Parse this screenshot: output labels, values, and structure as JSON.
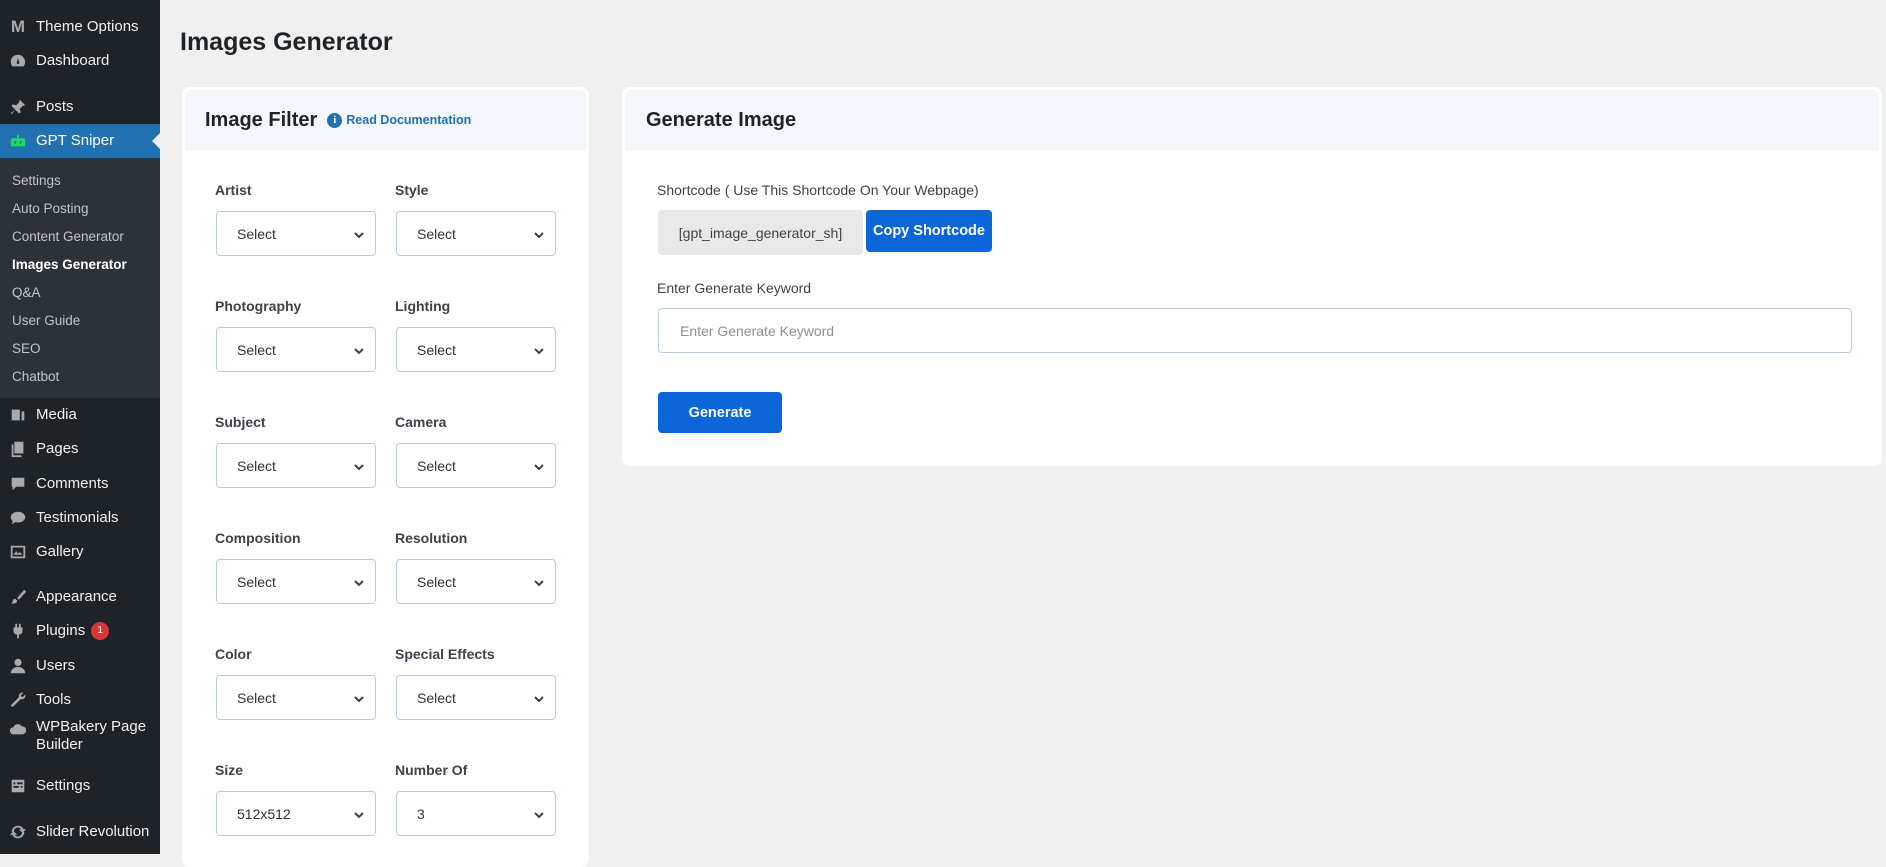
{
  "sidebar": {
    "top_items": [
      {
        "label": "Theme Options",
        "icon": "m-logo-icon"
      },
      {
        "label": "Dashboard",
        "icon": "dashboard-icon"
      },
      {
        "label": "Posts",
        "icon": "pin-icon"
      },
      {
        "label": "GPT Sniper",
        "icon": "robot-icon"
      }
    ],
    "submenu": [
      "Settings",
      "Auto Posting",
      "Content Generator",
      "Images Generator",
      "Q&A",
      "User Guide",
      "SEO",
      "Chatbot"
    ],
    "current_submenu": "Images Generator",
    "bottom_items": [
      {
        "label": "Media",
        "icon": "media-icon"
      },
      {
        "label": "Pages",
        "icon": "pages-icon"
      },
      {
        "label": "Comments",
        "icon": "comment-icon"
      },
      {
        "label": "Testimonials",
        "icon": "testimonial-icon"
      },
      {
        "label": "Gallery",
        "icon": "gallery-icon"
      },
      {
        "label": "Appearance",
        "icon": "brush-icon"
      },
      {
        "label": "Plugins",
        "icon": "plugin-icon",
        "badge": "1"
      },
      {
        "label": "Users",
        "icon": "user-icon"
      },
      {
        "label": "Tools",
        "icon": "wrench-icon"
      },
      {
        "label": "WPBakery Page",
        "label2": "Builder",
        "icon": "cloud-icon"
      },
      {
        "label": "Settings",
        "icon": "settings-icon"
      },
      {
        "label": "Slider Revolution",
        "icon": "refresh-icon"
      }
    ],
    "colors": {
      "bg": "#1d2327",
      "active": "#2271b1",
      "submenu_bg": "#2c3338"
    }
  },
  "page": {
    "title": "Images Generator"
  },
  "filter": {
    "title": "Image Filter",
    "doc_link": "Read Documentation",
    "fields": [
      {
        "label": "Artist",
        "value": "Select"
      },
      {
        "label": "Style",
        "value": "Select"
      },
      {
        "label": "Photography",
        "value": "Select"
      },
      {
        "label": "Lighting",
        "value": "Select"
      },
      {
        "label": "Subject",
        "value": "Select"
      },
      {
        "label": "Camera",
        "value": "Select"
      },
      {
        "label": "Composition",
        "value": "Select"
      },
      {
        "label": "Resolution",
        "value": "Select"
      },
      {
        "label": "Color",
        "value": "Select"
      },
      {
        "label": "Special Effects",
        "value": "Select"
      },
      {
        "label": "Size",
        "value": "512x512"
      },
      {
        "label": "Number Of",
        "value": "3"
      }
    ]
  },
  "generate": {
    "title": "Generate Image",
    "shortcode_label": "Shortcode ( Use This Shortcode On Your Webpage)",
    "shortcode_value": "[gpt_image_generator_sh]",
    "copy_button": "Copy Shortcode",
    "keyword_label": "Enter Generate Keyword",
    "keyword_placeholder": "Enter Generate Keyword",
    "keyword_value": "",
    "generate_button": "Generate",
    "accent": "#0b66d9"
  }
}
